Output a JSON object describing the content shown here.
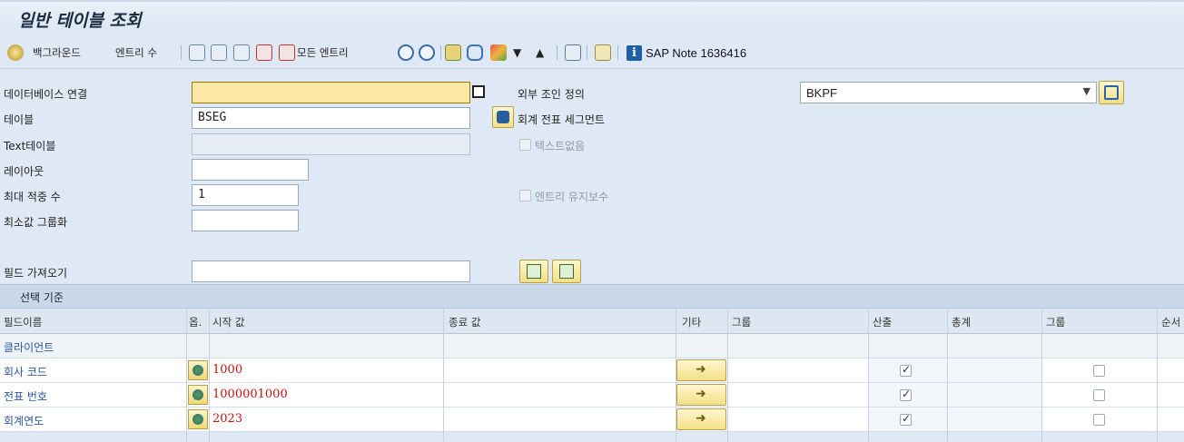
{
  "title": "일반 테이블 조회",
  "toolbar": {
    "background": "백그라운드",
    "entry_count": "엔트리 수",
    "all_entries": "모든 엔트리",
    "sap_note": "SAP Note 1636416"
  },
  "form": {
    "db_connection_label": "데이터베이스 연결",
    "db_connection_value": "",
    "table_label": "테이블",
    "table_value": "BSEG",
    "table_desc": "회계 전표 세그먼트",
    "text_table_label": "Text테이블",
    "text_table_value": "",
    "layout_label": "레이아웃",
    "layout_value": "",
    "max_hits_label": "최대 적중 수",
    "max_hits_value": "1",
    "min_group_label": "최소값 그룹화",
    "min_group_value": "",
    "fetch_fields_label": "필드 가져오기",
    "fetch_fields_value": "",
    "outer_join_label": "외부 조인 정의",
    "outer_join_value": "BKPF",
    "no_text_label": "텍스트없음",
    "maint_entries_label": "엔트리 유지보수"
  },
  "section": {
    "title": "선택 기준"
  },
  "grid": {
    "headers": [
      "필드이름",
      "옵.",
      "시작 값",
      "종료 값",
      "기타",
      "그룹",
      "산출",
      "총계",
      "그룹",
      "순서"
    ],
    "rows": [
      {
        "name": "클라이언트",
        "start": "",
        "output": false,
        "group": false,
        "show_controls": false
      },
      {
        "name": "회사 코드",
        "start": "1000",
        "output": true,
        "group": false,
        "show_controls": true
      },
      {
        "name": "전표 번호",
        "start": "1000001000",
        "output": true,
        "group": false,
        "show_controls": true
      },
      {
        "name": "회계연도",
        "start": "2023",
        "output": true,
        "group": false,
        "show_controls": true
      }
    ]
  },
  "colors": {
    "accent": "#2a57a0",
    "required_field": "#fbe7a6",
    "value_red": "#c81010"
  }
}
